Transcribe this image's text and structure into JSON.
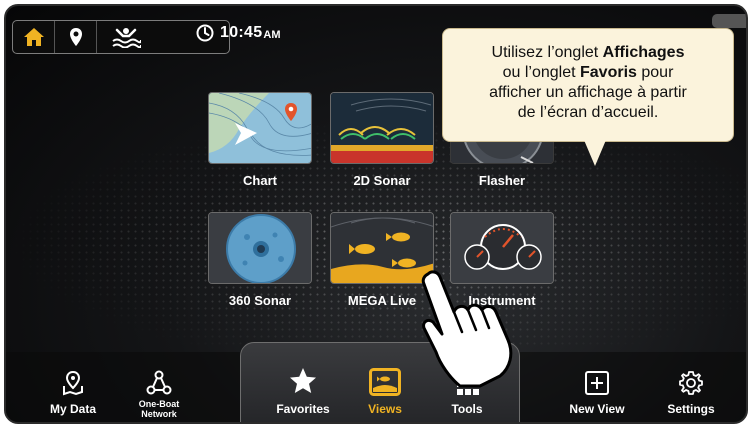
{
  "status_bar": {
    "time": "10:45",
    "ampm": "AM",
    "icons": [
      "home-icon",
      "waypoint-icon",
      "man-overboard-icon",
      "clock-icon"
    ]
  },
  "tooltip": {
    "line1_pre": "Utilisez l’onglet ",
    "line1_bold": "Affichages",
    "line2_pre": "ou l’onglet ",
    "line2_bold": "Favoris",
    "line2_post": " pour",
    "line3": "afficher un affichage à partir",
    "line4": "de l’écran d’accueil."
  },
  "tiles": [
    {
      "label": "Chart"
    },
    {
      "label": "2D Sonar"
    },
    {
      "label": "Flasher"
    },
    {
      "label": "360 Sonar"
    },
    {
      "label": "MEGA Live"
    },
    {
      "label": "Instrument"
    }
  ],
  "nav": {
    "my_data": "My Data",
    "one_boat_l1": "One-Boat",
    "one_boat_l2": "Network",
    "favorites": "Favorites",
    "views": "Views",
    "tools": "Tools",
    "new_view": "New View",
    "settings": "Settings"
  },
  "colors": {
    "accent": "#f0b323",
    "tooltip_bg": "#fbf3dc"
  }
}
